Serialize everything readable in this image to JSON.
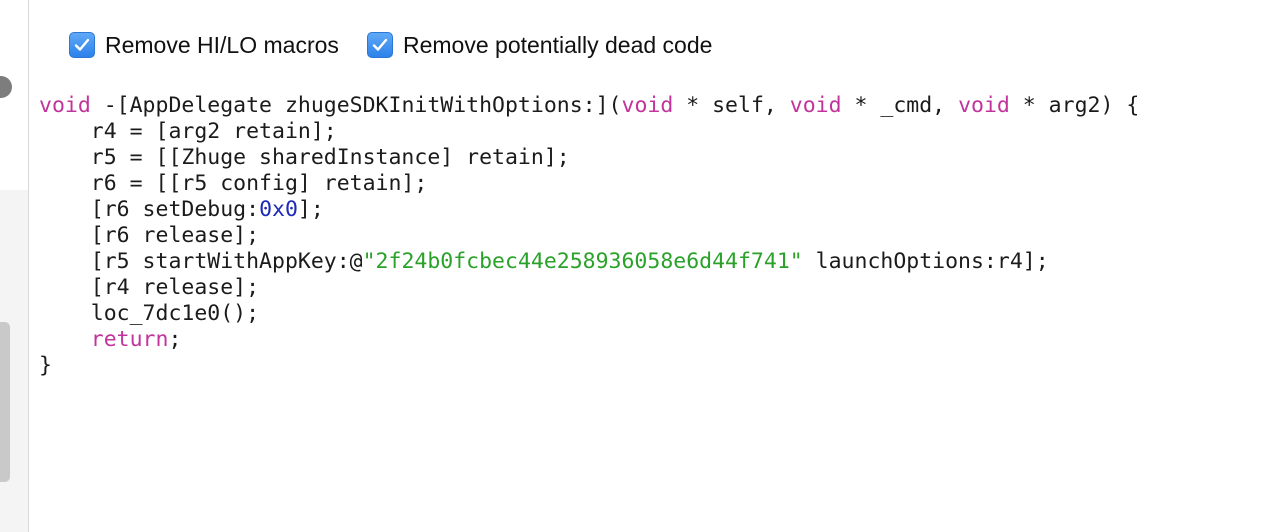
{
  "options": [
    {
      "label": "Remove HI/LO macros",
      "checked": true
    },
    {
      "label": "Remove potentially dead code",
      "checked": true
    }
  ],
  "colors": {
    "keyword": "#c2349b",
    "number": "#1c2ab7",
    "string": "#2aa22a",
    "text": "#1b1b1b",
    "checkbox": "#2d82ea"
  },
  "code": {
    "l1": {
      "kw1": "void",
      "a": " -[AppDelegate zhugeSDKInitWithOptions:](",
      "kw2": "void",
      "b": " * self, ",
      "kw3": "void",
      "c": " * _cmd, ",
      "kw4": "void",
      "d": " * arg2) {"
    },
    "l2": "    r4 = [arg2 retain];",
    "l3": "    r5 = [[Zhuge sharedInstance] retain];",
    "l4": "    r6 = [[r5 config] retain];",
    "l5": {
      "a": "    [r6 setDebug:",
      "num": "0x0",
      "b": "];"
    },
    "l6": "    [r6 release];",
    "l7": {
      "a": "    [r5 startWithAppKey:@",
      "str": "\"2f24b0fcbec44e258936058e6d44f741\"",
      "b": " launchOptions:r4];"
    },
    "l8": "    [r4 release];",
    "l9": "    loc_7dc1e0();",
    "l10": {
      "indent": "    ",
      "kw": "return",
      "b": ";"
    },
    "l11": "}"
  }
}
